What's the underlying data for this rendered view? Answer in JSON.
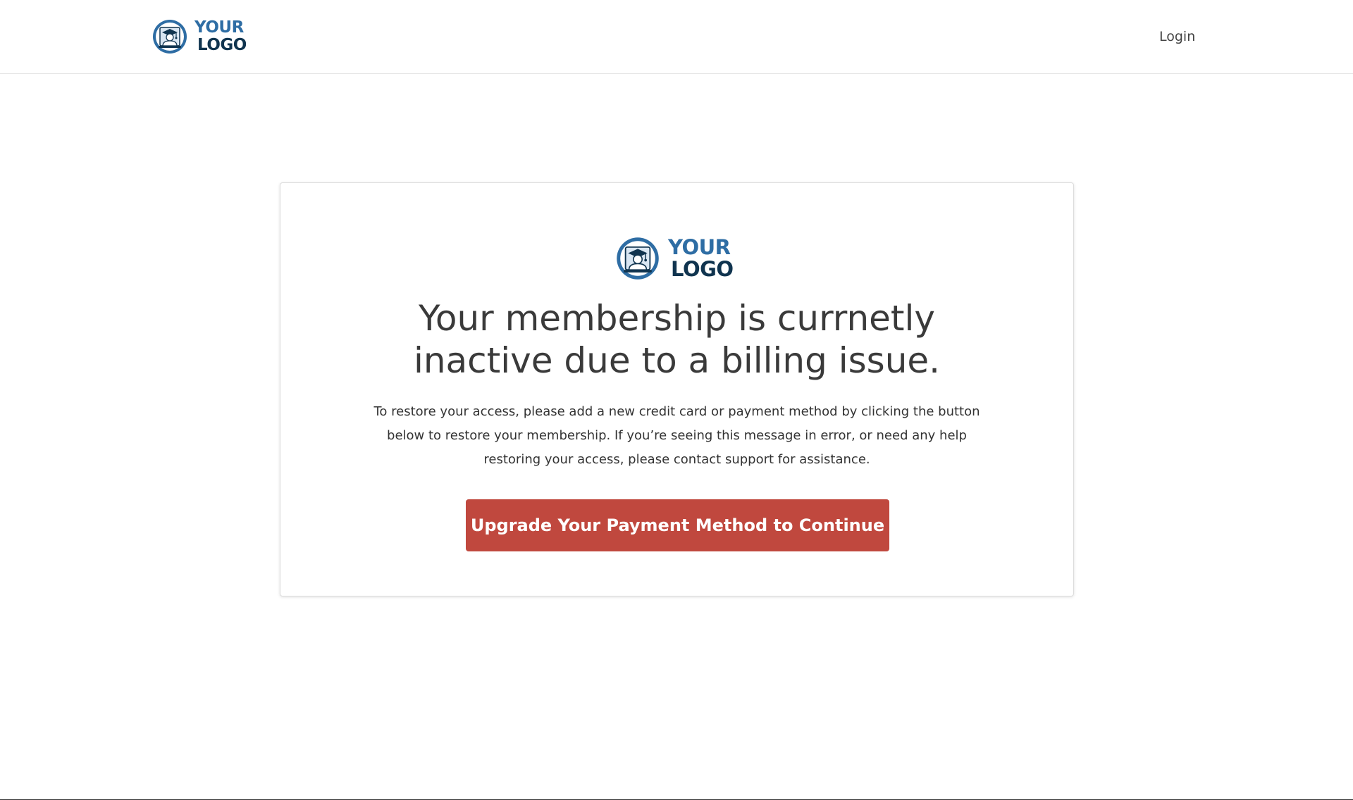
{
  "colors": {
    "logo_primary": "#2e6da4",
    "logo_secondary": "#10344f",
    "cta_background": "#c0483e",
    "text": "#333333"
  },
  "header": {
    "logo": {
      "icon": "graduate-screen-icon",
      "line1": "YOUR",
      "line2": "LOGO"
    },
    "login_label": "Login"
  },
  "card": {
    "logo": {
      "icon": "graduate-screen-icon",
      "line1": "YOUR",
      "line2": "LOGO"
    },
    "headline": "Your membership is currnetly inactive due to a billing issue.",
    "message": "To restore your access, please add a new credit card or payment method by clicking the button below to restore your membership. If you’re seeing this message in error, or need any help restoring your access, please contact support for assistance.",
    "cta_label": "Upgrade Your Payment Method to Continue"
  }
}
